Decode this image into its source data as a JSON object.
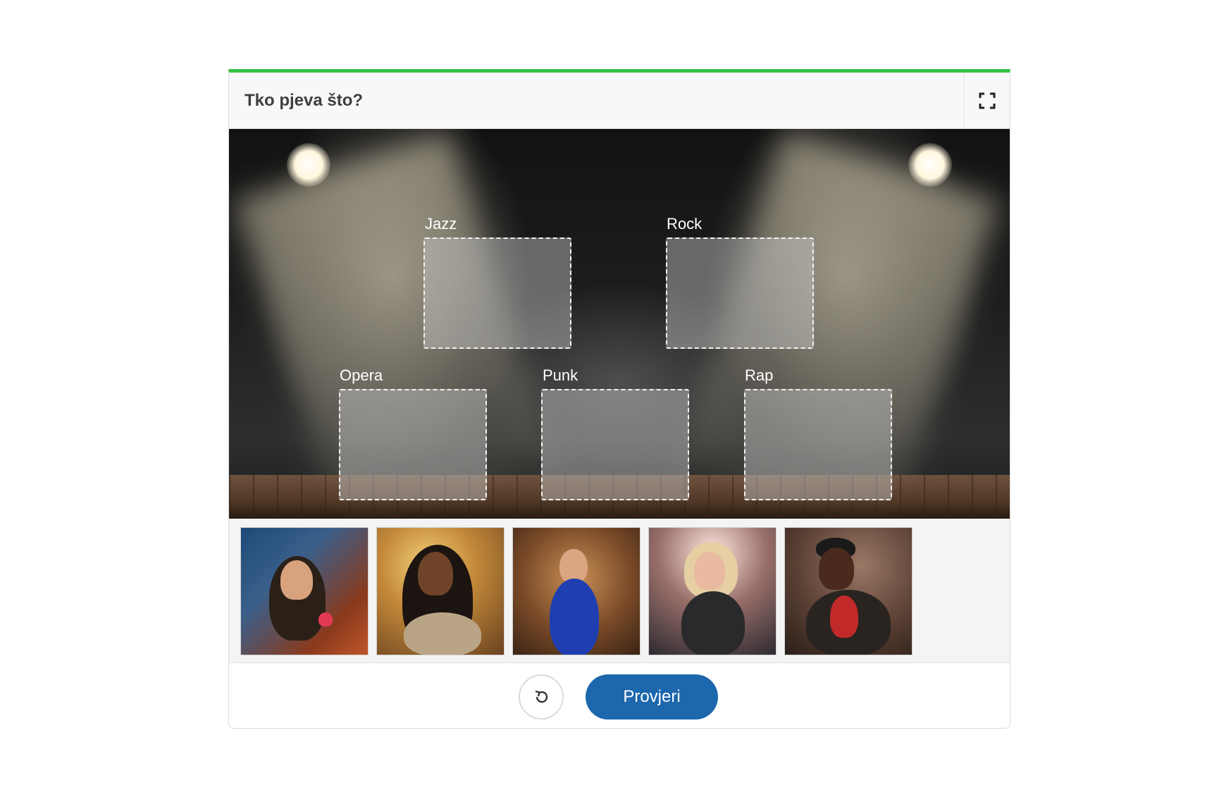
{
  "header": {
    "title": "Tko pjeva što?",
    "fullscreen_icon": "fullscreen-icon"
  },
  "zones": [
    {
      "label": "Jazz"
    },
    {
      "label": "Rock"
    },
    {
      "label": "Opera"
    },
    {
      "label": "Punk"
    },
    {
      "label": "Rap"
    }
  ],
  "cards": [
    {
      "image": "rock-singer-with-sunglasses"
    },
    {
      "image": "jazz-singer-with-microphone"
    },
    {
      "image": "opera-singer-in-blue-dress"
    },
    {
      "image": "punk-singer-blonde"
    },
    {
      "image": "rap-singer-with-cap"
    }
  ],
  "footer": {
    "retry_icon": "retry-icon",
    "check_label": "Provjeri"
  },
  "colors": {
    "accent": "#35c045",
    "button": "#1d67ad"
  }
}
